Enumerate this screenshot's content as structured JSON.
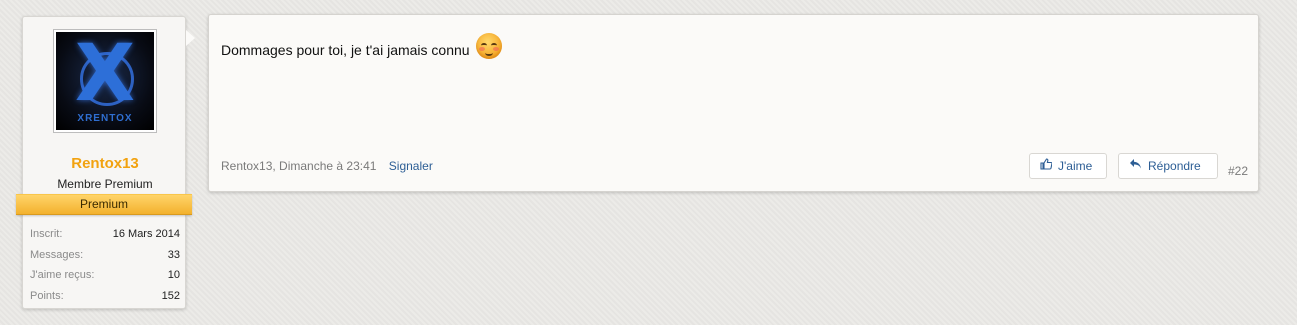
{
  "user": {
    "avatar_text": "XRENTOX",
    "avatar_letter": "X",
    "username": "Rentox13",
    "title": "Membre Premium",
    "banner": "Premium",
    "stats": [
      {
        "label": "Inscrit:",
        "value": "16 Mars 2014"
      },
      {
        "label": "Messages:",
        "value": "33"
      },
      {
        "label": "J'aime reçus:",
        "value": "10"
      },
      {
        "label": "Points:",
        "value": "152"
      }
    ]
  },
  "post": {
    "text": "Dommages pour toi, je t'ai jamais connu",
    "emoji_icon": "flushed-face-emoji",
    "meta": "Rentox13, Dimanche à 23:41",
    "report": "Signaler",
    "like_label": "J'aime",
    "like_icon": "thumbs-up-icon",
    "reply_label": "Répondre",
    "reply_icon": "reply-arrow-icon",
    "number": "#22"
  },
  "colors": {
    "username": "#f2a20f",
    "banner": "#f3b12d",
    "link": "#2d5e95"
  }
}
